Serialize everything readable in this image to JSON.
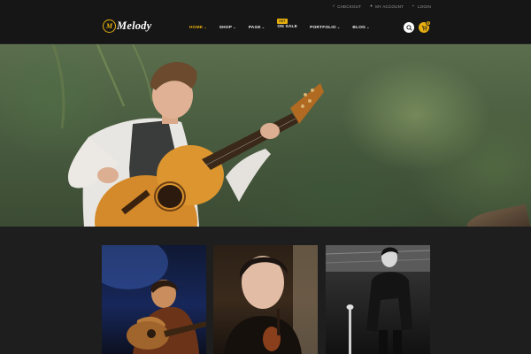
{
  "topbar": {
    "links": [
      {
        "label": "CHECKOUT",
        "icon": "check-icon"
      },
      {
        "label": "MY ACCOUNT",
        "icon": "user-icon"
      },
      {
        "label": "LOGIN",
        "icon": "lock-icon"
      }
    ]
  },
  "header": {
    "logo_mark": "M",
    "logo_text": "Melody",
    "nav": [
      {
        "label": "HOME",
        "caret": "⌄",
        "active": true
      },
      {
        "label": "SHOP",
        "caret": "⌄"
      },
      {
        "label": "PAGE",
        "caret": "⌄"
      },
      {
        "label": "ON SALE",
        "caret": "",
        "badge": "HOT"
      },
      {
        "label": "PORTFOLIO",
        "caret": "⌄"
      },
      {
        "label": "BLOG",
        "caret": "⌄"
      }
    ],
    "cart_count": "0"
  },
  "colors": {
    "accent": "#e9b10f",
    "header_bg": "#161616",
    "page_bg": "#1e1e1e"
  },
  "hero": {
    "image": "guitarist playing classical guitar in a green forest"
  },
  "gallery": [
    {
      "image": "guitarist playing on stage under blue light"
    },
    {
      "image": "portrait of a young violinist"
    },
    {
      "image": "black and white guitarist standing with guitar"
    }
  ]
}
